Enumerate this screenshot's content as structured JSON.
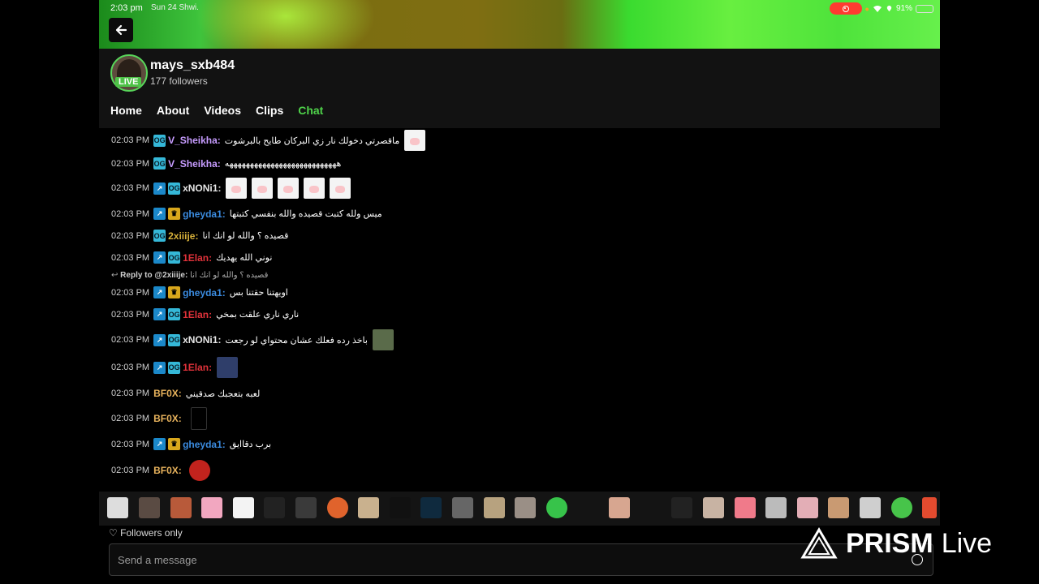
{
  "status_bar": {
    "time": "2:03 pm",
    "date": "Sun 24 Shwi.",
    "battery": "91%",
    "battery_level": 0.91
  },
  "channel": {
    "username": "mays_sxb484",
    "followers": "177 followers",
    "live_label": "LIVE"
  },
  "tabs": [
    "Home",
    "About",
    "Videos",
    "Clips",
    "Chat"
  ],
  "active_tab": "Chat",
  "colors": {
    "accent": "#4fd34a",
    "live": "#4ec247"
  },
  "messages": [
    {
      "time": "02:03 PM",
      "user": "V_Sheikha:",
      "text": "ماقصرتي دخولك نار زي البركان طايح بالبرشوت",
      "color": "#c79cff"
    },
    {
      "time": "02:03 PM",
      "user": "V_Sheikha:",
      "text": "هههههههههههههههههههههههههههه",
      "color": "#c79cff"
    },
    {
      "time": "02:03 PM",
      "user": "xNONi1:",
      "text": "",
      "color": "#e6e6e6"
    },
    {
      "time": "02:03 PM",
      "user": "gheyda1:",
      "text": "ميس ولله كتبت قصيده والله بنفسي كتبتها",
      "color": "#3b8ce0"
    },
    {
      "time": "02:03 PM",
      "user": "2xiiije:",
      "text": "قصيده ؟ والله لو انك انا",
      "color": "#d7b13a"
    },
    {
      "time": "02:03 PM",
      "user": "1Elan:",
      "text": "نوني الله يهديك",
      "color": "#e0323a"
    },
    {
      "time": "02:03 PM",
      "user": "gheyda1:",
      "text": "اويهتنا حقتنا بس",
      "color": "#3b8ce0"
    },
    {
      "time": "02:03 PM",
      "user": "1Elan:",
      "text": "ناري ناري علقت بمخي",
      "color": "#e0323a"
    },
    {
      "time": "02:03 PM",
      "user": "xNONi1:",
      "text": "باخذ رده فعلك عشان محتواي لو رجعت",
      "color": "#e6e6e6"
    },
    {
      "time": "02:03 PM",
      "user": "1Elan:",
      "text": "",
      "color": "#e0323a"
    },
    {
      "time": "02:03 PM",
      "user": "BF0X:",
      "text": "لعبه بتعجبك صدقيني",
      "color": "#e7b25c"
    },
    {
      "time": "02:03 PM",
      "user": "BF0X:",
      "text": "",
      "color": "#e7b25c"
    },
    {
      "time": "02:03 PM",
      "user": "gheyda1:",
      "text": "برب دقاايق",
      "color": "#3b8ce0"
    },
    {
      "time": "02:03 PM",
      "user": "BF0X:",
      "text": "",
      "color": "#e7b25c"
    }
  ],
  "reply": {
    "label": "Reply to @2xiiije:",
    "quote": "قصيده ؟ والله لو انك انا"
  },
  "followers_only": "Followers only",
  "input": {
    "placeholder": "Send a message"
  },
  "watermark": {
    "brand": "PRISM",
    "suffix": "Live"
  }
}
